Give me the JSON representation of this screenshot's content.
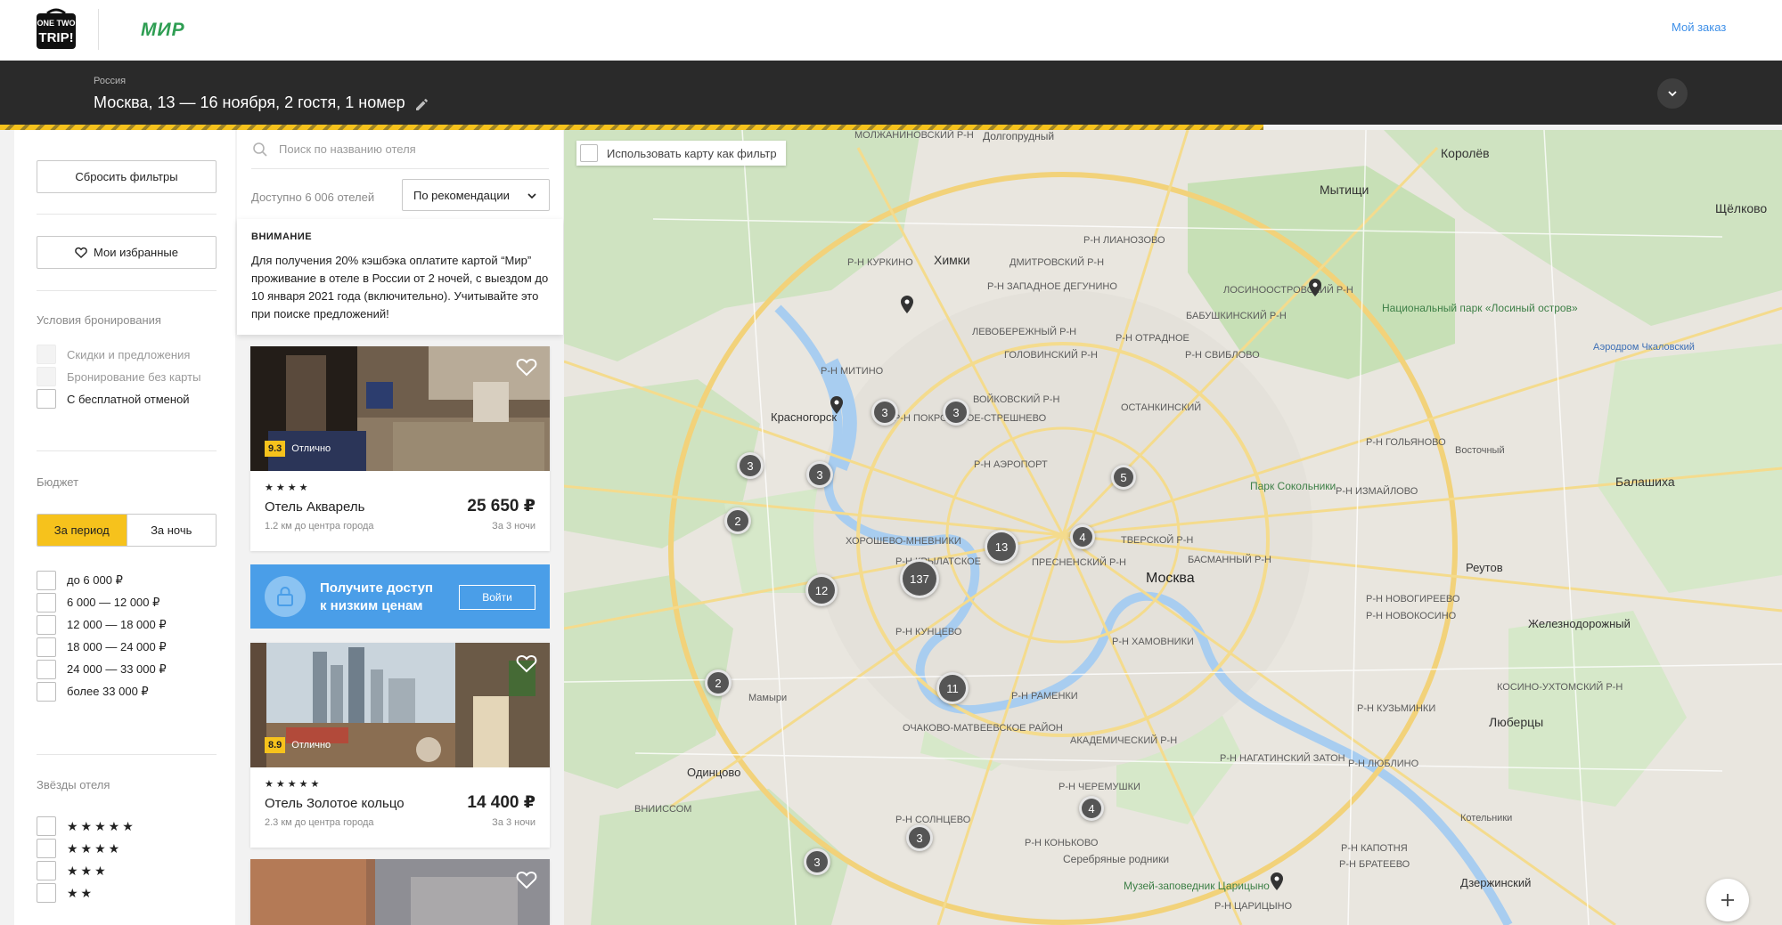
{
  "header": {
    "brand": "ONE TWO TRIP!",
    "partner": "МИР",
    "my_order": "Мой заказ"
  },
  "search": {
    "country": "Россия",
    "query": "Москва, 13 — 16 ноября, 2 гостя, 1 номер"
  },
  "filters": {
    "reset": "Сбросить фильтры",
    "favorites": "Мои избранные",
    "booking_title": "Условия бронирования",
    "booking": [
      {
        "label": "Скидки и предложения",
        "enabled": false
      },
      {
        "label": "Бронирование без карты",
        "enabled": false
      },
      {
        "label": "С бесплатной отменой",
        "enabled": true
      }
    ],
    "budget_title": "Бюджет",
    "budget_modes": [
      "За период",
      "За ночь"
    ],
    "budget_selected": "За период",
    "budget": [
      "до 6 000 ₽",
      "6 000 — 12 000 ₽",
      "12 000 — 18 000 ₽",
      "18 000 — 24 000 ₽",
      "24 000 — 33 000 ₽",
      "более 33 000 ₽"
    ],
    "stars_title": "Звёзды отеля",
    "stars": [
      "★★★★★",
      "★★★★",
      "★★★",
      "★★"
    ]
  },
  "list": {
    "search_placeholder": "Поиск по названию отеля",
    "available": "Доступно 6 006 отелей",
    "sort": "По рекомендации",
    "notice_title": "ВНИМАНИЕ",
    "notice_body": "Для получения 20% кэшбэка оплатите картой “Мир” проживание в отеле в России от 2 ночей, с выездом до 10 января 2021 года (включительно). Учитывайте это при поиске предложений!",
    "hotels": [
      {
        "score": "9.3",
        "rating_word": "Отлично",
        "stars": "★★★★",
        "name": "Отель Акварель",
        "distance": "1.2 км до центра города",
        "price": "25 650 ₽",
        "nights": "За 3 ночи"
      },
      {
        "score": "8.9",
        "rating_word": "Отлично",
        "stars": "★★★★★",
        "name": "Отель Золотое кольцо",
        "distance": "2.3 км до центра города",
        "price": "14 400 ₽",
        "nights": "За 3 ночи"
      }
    ],
    "promo_line1": "Получите доступ",
    "promo_line2": "к низким ценам",
    "promo_button": "Войти"
  },
  "map": {
    "use_as_filter": "Использовать карту как фильтр",
    "clusters": [
      "3",
      "3",
      "3",
      "3",
      "2",
      "12",
      "137",
      "13",
      "4",
      "5",
      "2",
      "11",
      "4",
      "3",
      "3"
    ],
    "labels": {
      "moscow": "Москва",
      "khimki": "Химки",
      "korolev": "Королёв",
      "mytishchi": "Мытищи",
      "shchelkovo": "Щёлково",
      "balashikha": "Балашиха",
      "reutov": "Реутов",
      "lyubertsy": "Люберцы",
      "odintsovo": "Одинцово",
      "krasnogorsk": "Красногорск",
      "dolgoprudny": "Долгопрудный",
      "zheleznodorozhny": "Железнодорожный",
      "dzerzhinsky": "Дзержинский",
      "vnukovo": "ВНИИССОМ",
      "losiny": "Национальный парк «Лосиный остров»",
      "sokolniki": "Парк Сокольники",
      "tsaritsyno": "Музей-заповедник Царицыно",
      "khamovniki": "Р-Н ХАМОВНИКИ",
      "presnensky": "ПРЕСНЕНСКИЙ Р-Н",
      "tverskoy": "ТВЕРСКОЙ Р-Н",
      "basmanny": "БАСМАННЫЙ Р-Н",
      "ostankinsky": "ОСТАНКИНСКИЙ",
      "izmaylovo": "Р-Н ИЗМАЙЛОВО",
      "kuzminki": "Р-Н КУЗЬМИНКИ",
      "khoroshevo": "ХОРОШЕВО-МНЕВНИКИ",
      "krylatskoe": "Р-Н КРЫЛАТСКОЕ",
      "kuntsevo": "Р-Н КУНЦЕВО",
      "ramenki": "Р-Н РАМЕНКИ",
      "akademichesky": "АКАДЕМИЧЕСКИЙ Р-Н",
      "cheremushki": "Р-Н ЧЕРЕМУШКИ",
      "konkovo": "Р-Н КОНЬКОВО",
      "solntsevo": "Р-Н СОЛНЦЕВО",
      "tsaritsyno_d": "Р-Н ЦАРИЦЫНО",
      "brateevo": "Р-Н БРАТЕЕВО",
      "kapotnya": "Р-Н КАПОТНЯ",
      "lyublino": "Р-Н ЛЮБЛИНО",
      "novogireevo": "Р-Н НОВОГИРЕЕВО",
      "novokosino": "Р-Н НОВОКОСИНО",
      "goltsevo": "Р-Н ГОЛЬЯНОВО",
      "losinoostrovsky": "ЛОСИНООСТРОВСКИЙ Р-Н",
      "babushkinsky": "БАБУШКИНСКИЙ Р-Н",
      "otradnoe": "Р-Н ОТРАДНОЕ",
      "sviblovo": "Р-Н СВИБЛОВО",
      "golovinsky": "ГОЛОВИНСКИЙ Р-Н",
      "levoberezhny": "ЛЕВОБЕРЕЖНЫЙ Р-Н",
      "voykovsky": "ВОЙКОВСКИЙ Р-Н",
      "pokrovskoe": "Р-Н ПОКРОВСКОЕ-СТРЕШНЕВО",
      "mitino": "Р-Н МИТИНО",
      "kurkino": "Р-Н КУРКИНО",
      "dmitrovsky": "ДМИТРОВСКИЙ Р-Н",
      "lianozovo": "Р-Н ЛИАНОЗОВО",
      "zapadnoe": "Р-Н ЗАПАДНОЕ ДЕГУНИНО",
      "aeroport": "Р-Н АЭРОПОРТ",
      "ochakovo": "ОЧАКОВО-МАТВЕЕВСКОЕ РАЙОН",
      "nagatinsky": "Р-Н НАГАТИНСКИЙ ЗАТОН",
      "kosino": "КОСИНО-УХТОМСКИЙ Р-Н",
      "molzhaninovsky": "МОЛЖАНИНОВСКИЙ Р-Н",
      "chkalovsky": "Аэродром Чкаловский",
      "vostochny": "Восточный",
      "kotelniki": "Котельники",
      "mamyri": "Мамыри",
      "serebryanye": "Серебряные родники"
    },
    "zoom_in": "+"
  }
}
